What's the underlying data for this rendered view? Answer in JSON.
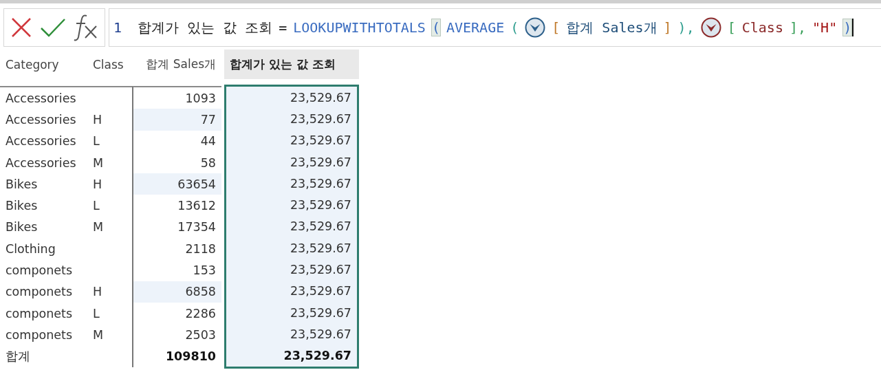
{
  "formula_bar": {
    "line_number": "1",
    "tokens": [
      {
        "kind": "text",
        "text": "합계가 있는 값 조회",
        "color": "#1e1e1e"
      },
      {
        "kind": "text",
        "text": "=",
        "color": "#1e1e1e"
      },
      {
        "kind": "text",
        "text": "LOOKUPWITHTOTALS",
        "color": "#3a6cc0"
      },
      {
        "kind": "bracket",
        "text": "(",
        "color": "#3a6cc0",
        "matched": true
      },
      {
        "kind": "text",
        "text": "AVERAGE",
        "color": "#3a6cc0"
      },
      {
        "kind": "text",
        "text": "(",
        "color": "#2f9e8f"
      },
      {
        "kind": "measure-icon",
        "color": "#2c5f8a"
      },
      {
        "kind": "text",
        "text": "[",
        "color": "#c07a2c"
      },
      {
        "kind": "text",
        "text": "합계 Sales개",
        "color": "#1f4e79"
      },
      {
        "kind": "text",
        "text": "]",
        "color": "#c07a2c"
      },
      {
        "kind": "text",
        "text": "),",
        "color": "#2f9e8f"
      },
      {
        "kind": "column-icon",
        "color": "#8b2a2a"
      },
      {
        "kind": "text",
        "text": "[",
        "color": "#3aa05a"
      },
      {
        "kind": "text",
        "text": "Class",
        "color": "#8b2a2a"
      },
      {
        "kind": "text",
        "text": "],",
        "color": "#3aa05a"
      },
      {
        "kind": "text",
        "text": "\"H\"",
        "color": "#a31515"
      },
      {
        "kind": "bracket",
        "text": ")",
        "color": "#3a6cc0",
        "matched": true
      }
    ]
  },
  "table": {
    "columns": [
      {
        "label": "Category",
        "kind": "category",
        "selected": false
      },
      {
        "label": "Class",
        "kind": "class",
        "selected": false
      },
      {
        "label": "합계 Sales개",
        "kind": "sales",
        "selected": false
      },
      {
        "label": "합계가 있는 값 조회",
        "kind": "measure",
        "selected": true
      }
    ],
    "rows": [
      {
        "category": "Accessories",
        "sales": "1093",
        "measure": "23,529.67",
        "highlighted": false
      },
      {
        "category": "Accessories",
        "class": "H",
        "sales": "77",
        "measure": "23,529.67",
        "highlighted": true
      },
      {
        "category": "Accessories",
        "class": "L",
        "sales": "44",
        "measure": "23,529.67",
        "highlighted": false
      },
      {
        "category": "Accessories",
        "class": "M",
        "sales": "58",
        "measure": "23,529.67",
        "highlighted": false
      },
      {
        "category": "Bikes",
        "class": "H",
        "sales": "63654",
        "measure": "23,529.67",
        "highlighted": true
      },
      {
        "category": "Bikes",
        "class": "L",
        "sales": "13612",
        "measure": "23,529.67",
        "highlighted": false
      },
      {
        "category": "Bikes",
        "class": "M",
        "sales": "17354",
        "measure": "23,529.67",
        "highlighted": false
      },
      {
        "category": "Clothing",
        "sales": "2118",
        "measure": "23,529.67",
        "highlighted": false
      },
      {
        "category": "componets",
        "sales": "153",
        "measure": "23,529.67",
        "highlighted": false
      },
      {
        "category": "componets",
        "class": "H",
        "sales": "6858",
        "measure": "23,529.67",
        "highlighted": true
      },
      {
        "category": "componets",
        "class": "L",
        "sales": "2286",
        "measure": "23,529.67",
        "highlighted": false
      },
      {
        "category": "componets",
        "class": "M",
        "sales": "2503",
        "measure": "23,529.67",
        "highlighted": false
      }
    ],
    "total": {
      "category": "합계",
      "sales": "109810",
      "measure": "23,529.67"
    }
  }
}
